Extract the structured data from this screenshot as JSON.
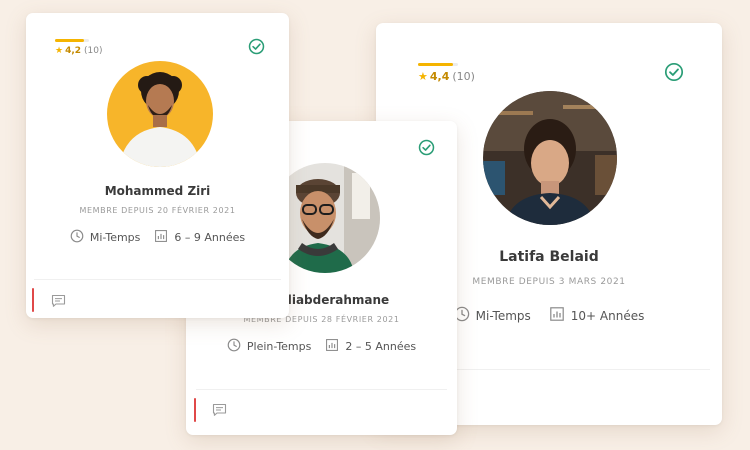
{
  "colors": {
    "background": "#f8efe6",
    "star": "#f5b400",
    "verified": "#2a9d76",
    "accent": "#e04848"
  },
  "cards": {
    "latifa": {
      "rating_value": "4,4",
      "rating_count": "(10)",
      "rating_level": 0.88,
      "name": "Latifa Belaid",
      "member_since": "MEMBRE DEPUIS 3 MARS 2021",
      "schedule": "Mi-Temps",
      "experience": "10+ Années",
      "icons": [
        "star-icon",
        "verified-check-icon",
        "clock-icon",
        "chart-icon"
      ]
    },
    "hakim": {
      "name": "m Sidiabderahmane",
      "member_since": "MEMBRE DEPUIS 28 FÉVRIER 2021",
      "schedule": "Plein-Temps",
      "experience": "2 – 5 Années",
      "icons": [
        "verified-check-icon",
        "clock-icon",
        "chart-icon",
        "message-icon"
      ]
    },
    "mohammed": {
      "rating_value": "4,2",
      "rating_count": "(10)",
      "rating_level": 0.84,
      "name": "Mohammed Ziri",
      "member_since": "MEMBRE DEPUIS 20 FÉVRIER 2021",
      "schedule": "Mi-Temps",
      "experience": "6 – 9 Années",
      "icons": [
        "star-icon",
        "verified-check-icon",
        "clock-icon",
        "chart-icon",
        "message-icon"
      ]
    }
  }
}
